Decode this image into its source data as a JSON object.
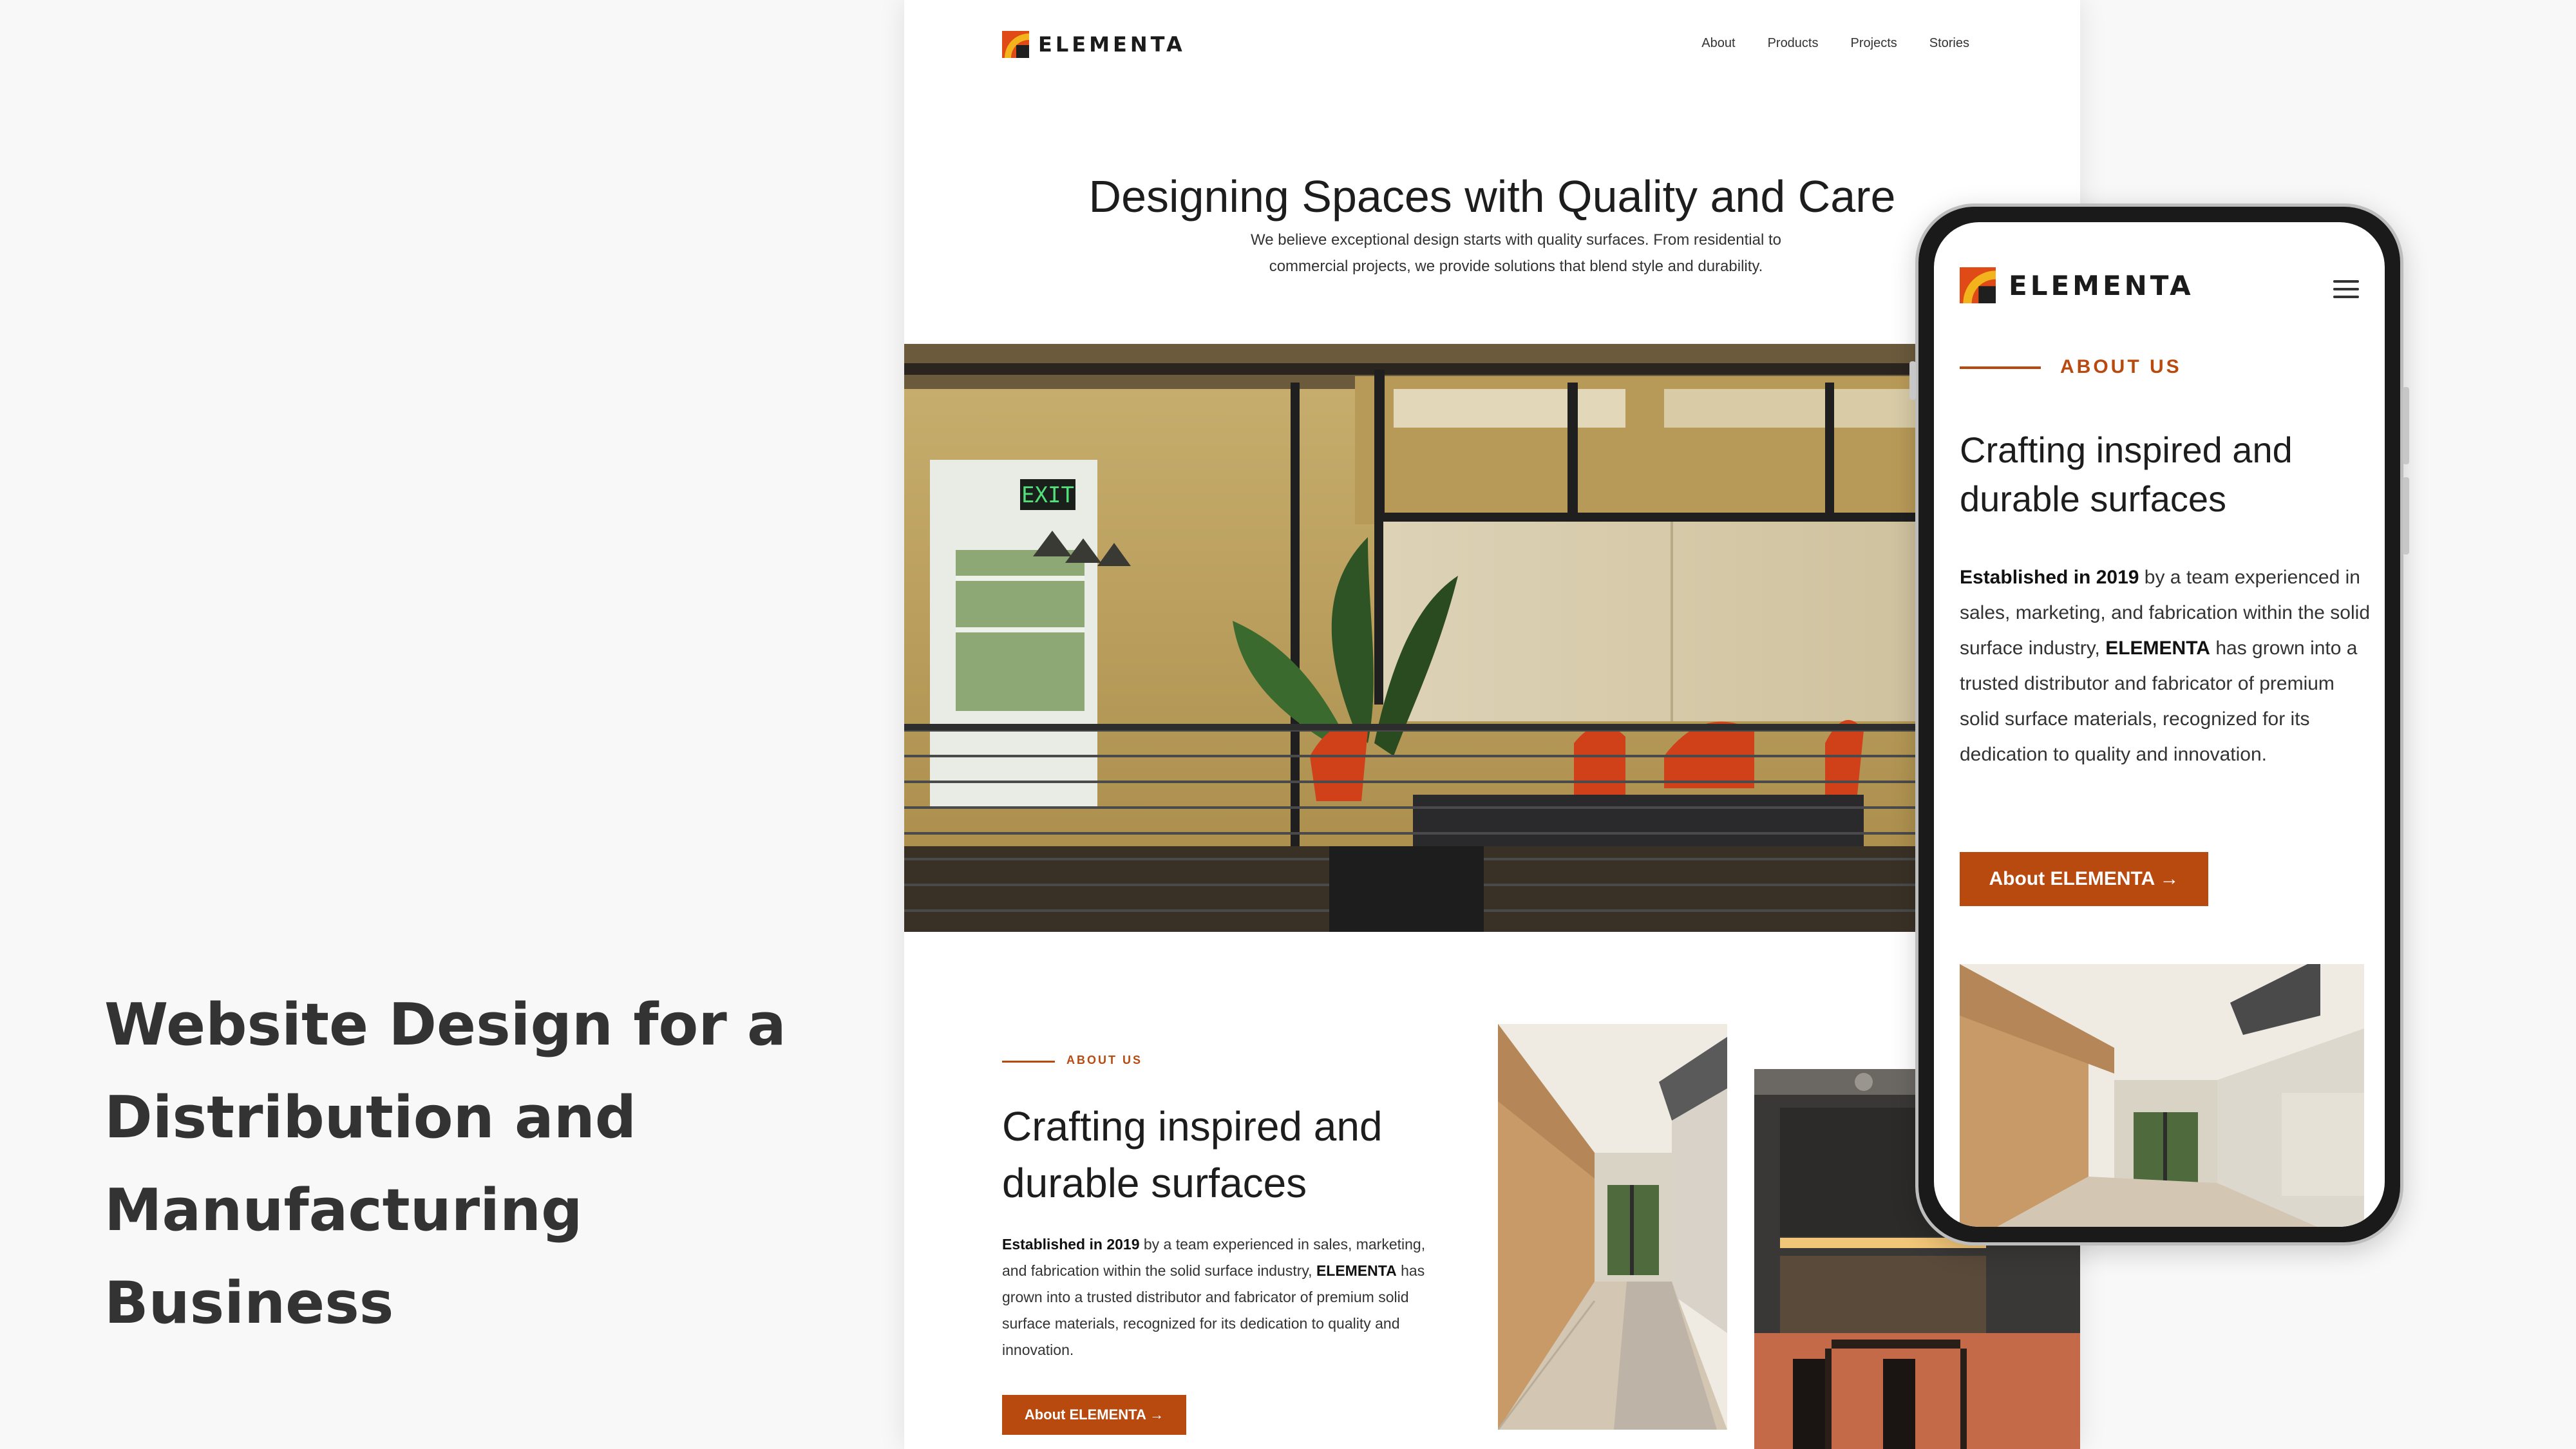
{
  "caption": {
    "line1": "Website Design for a",
    "line2": "Distribution and",
    "line3": "Manufacturing Business"
  },
  "brand": {
    "name": "ELEMENTA",
    "accent": "#b84a10",
    "logo_colors": [
      "#e04a16",
      "#f2b31c",
      "#1f1f1f"
    ]
  },
  "desktop": {
    "nav": {
      "items": [
        "About",
        "Products",
        "Projects",
        "Stories"
      ]
    },
    "hero": {
      "title": "Designing Spaces with Quality and Care",
      "text_line1": "We believe exceptional design starts with quality surfaces. From residential to",
      "text_line2": "commercial projects, we provide solutions that blend style and durability.",
      "exit_sign": "EXIT"
    },
    "about": {
      "label": "ABOUT US",
      "title_line1": "Crafting inspired and",
      "title_line2": "durable surfaces",
      "text_bold1": "Established in 2019",
      "text_part1": " by a team experienced in sales, marketing, and fabrication within the solid surface industry, ",
      "text_bold2": "ELEMENTA",
      "text_part2": " has grown into a trusted distributor and fabricator of premium solid surface materials, recognized for its dedication to quality and innovation.",
      "button": "About ELEMENTA →"
    }
  },
  "mobile": {
    "about": {
      "label": "ABOUT US",
      "title_line1": "Crafting inspired and",
      "title_line2": "durable surfaces",
      "text_bold1": "Established in 2019",
      "text_part1": " by a team experienced in sales, marketing, and fabrication within the solid surface industry, ",
      "text_bold2": "ELEMENTA",
      "text_part2": " has grown into a trusted distributor and fabricator of premium solid surface materials, recognized for its dedication to quality and innovation.",
      "button": "About ELEMENTA →"
    }
  }
}
